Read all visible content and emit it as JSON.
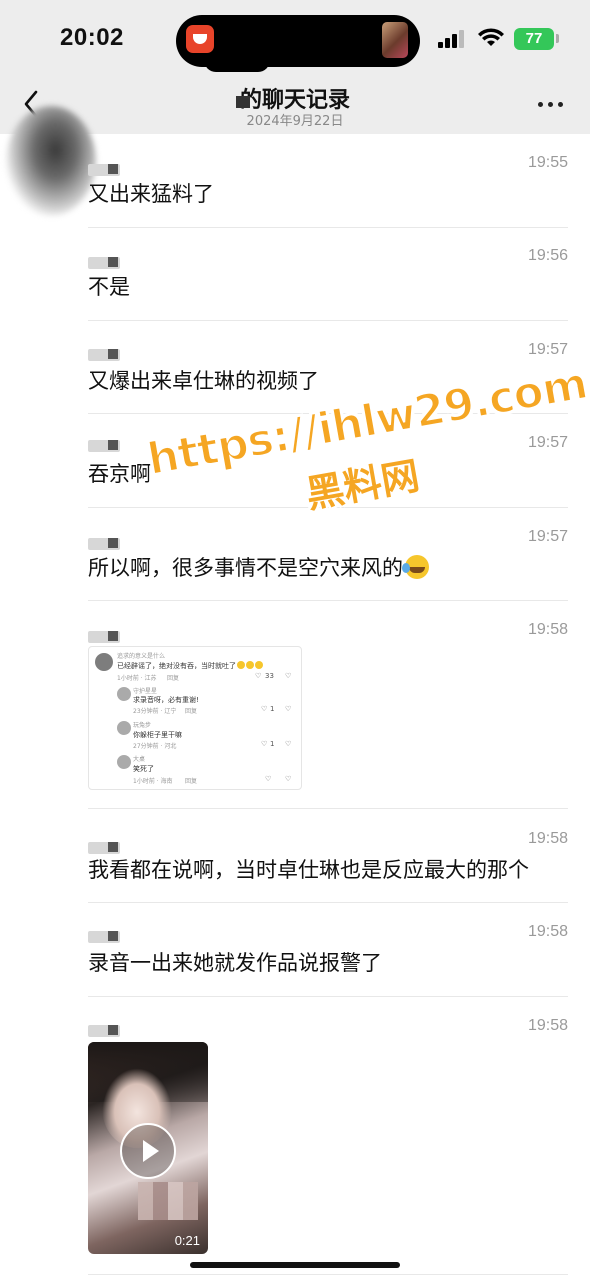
{
  "status_bar": {
    "time": "20:02",
    "battery": "77"
  },
  "nav": {
    "title": "的聊天记录",
    "date": "2024年9月22日"
  },
  "messages": [
    {
      "time": "19:55",
      "text": "又出来猛料了"
    },
    {
      "time": "19:56",
      "text": "不是"
    },
    {
      "time": "19:57",
      "text": "又爆出来卓仕琳的视频了"
    },
    {
      "time": "19:57",
      "text": "吞京啊"
    },
    {
      "time": "19:57",
      "text": "所以啊，很多事情不是空穴来风的"
    },
    {
      "time": "19:58",
      "text": ""
    },
    {
      "time": "19:58",
      "text": "我看都在说啊，当时卓仕琳也是反应最大的那个"
    },
    {
      "time": "19:58",
      "text": "录音一出来她就发作品说报警了"
    },
    {
      "time": "19:58",
      "text": ""
    }
  ],
  "comment_card": {
    "main": {
      "user": "追求的意义是什么",
      "text": "已经辟谣了，绝对没有吞，当时就吐了",
      "meta": "1小时前 · 江苏",
      "reply": "回复",
      "likes": "33"
    },
    "replies": [
      {
        "user": "守护星星",
        "text": "求录音呀，必有重谢!",
        "meta": "23分钟前 · 辽宁",
        "reply": "回复",
        "likes": "1"
      },
      {
        "user": "玩兔步",
        "text": "你躲柜子里干嘛",
        "meta": "27分钟前 · 河北",
        "reply": "回复",
        "likes": "1"
      },
      {
        "user": "大桌",
        "text": "笑死了",
        "meta": "1小时前 · 海南",
        "reply": "回复",
        "likes": ""
      }
    ]
  },
  "video": {
    "duration": "0:21"
  },
  "watermark": {
    "line1": "https://ihlw29.com",
    "line2": "黑料网"
  },
  "colors": {
    "accent": "#f5a623",
    "battery": "#34c759",
    "nav_bg": "#ededed"
  }
}
